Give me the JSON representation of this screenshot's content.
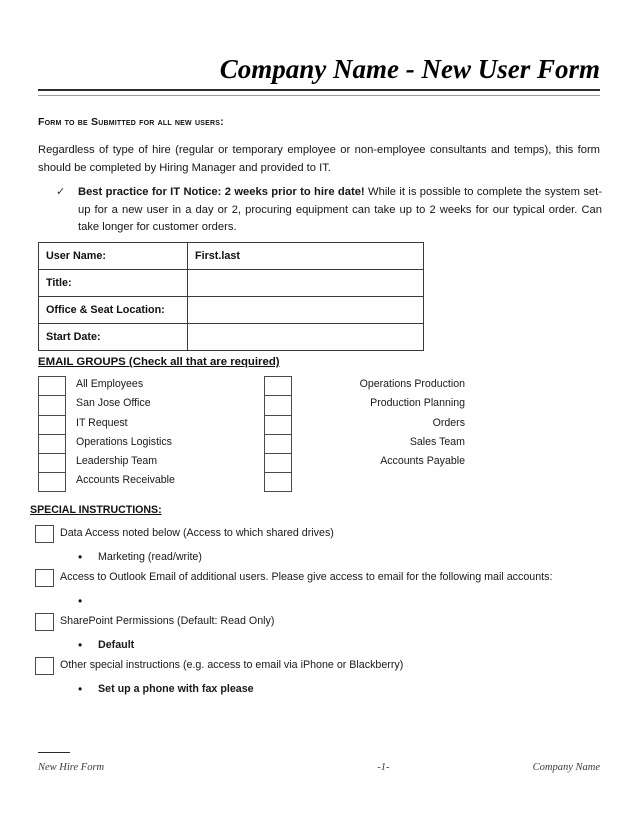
{
  "document": {
    "title": "Company Name - New User Form",
    "subhead": "Form to be Submitted for all new users:",
    "intro": "Regardless of type of hire (regular or temporary employee or non-employee consultants and temps), this form should be completed by Hiring Manager and provided to IT.",
    "note": {
      "bullet_icon": "checkmark-icon",
      "bullet_glyph": "✓",
      "bold_lead": "Best practice for IT Notice:   2 weeks prior to hire date!",
      "rest": " While it is possible to complete the system set-up for a new user in a day or 2, procuring equipment can take up to 2 weeks for our typical order.  Can take longer for customer orders."
    }
  },
  "info_table": {
    "rows": [
      {
        "label": "User Name:",
        "value": "First.last"
      },
      {
        "label": "Title:",
        "value": ""
      },
      {
        "label": "Office & Seat Location:",
        "value": ""
      },
      {
        "label": "Start Date:",
        "value": ""
      }
    ]
  },
  "email_groups": {
    "heading": "EMAIL GROUPS (Check all that are required)",
    "left_column": [
      {
        "label": "All Employees",
        "checked": false
      },
      {
        "label": "San Jose Office",
        "checked": false
      },
      {
        "label": "IT Request",
        "checked": false
      },
      {
        "label": "Operations Logistics",
        "checked": false
      },
      {
        "label": "Leadership Team",
        "checked": false
      },
      {
        "label": "Accounts Receivable",
        "checked": false
      }
    ],
    "right_column": [
      {
        "label": "Operations Production",
        "checked": false
      },
      {
        "label": "Production Planning",
        "checked": false
      },
      {
        "label": "Orders",
        "checked": false
      },
      {
        "label": "Sales Team",
        "checked": false
      },
      {
        "label": "Accounts Payable",
        "checked": false
      },
      {
        "label": "",
        "checked": false
      }
    ]
  },
  "special_instructions": {
    "heading": "SPECIAL INSTRUCTIONS:",
    "items": [
      {
        "label": "Data Access noted below (Access to which shared drives)",
        "checked": false,
        "sub_bullets": [
          {
            "text": "Marketing (read/write)",
            "bold": false
          }
        ]
      },
      {
        "label": "Access to Outlook Email of additional users.  Please give access to email for the following mail accounts:",
        "checked": false,
        "sub_bullets": [
          {
            "text": "",
            "bold": false
          }
        ]
      },
      {
        "label": "SharePoint Permissions (Default: Read Only)",
        "checked": false,
        "sub_bullets": [
          {
            "text": "Default",
            "bold": true
          }
        ]
      },
      {
        "label": "Other special instructions (e.g. access to email via iPhone or Blackberry)",
        "checked": false,
        "sub_bullets": [
          {
            "text": "Set up a phone with fax please",
            "bold": true
          }
        ]
      }
    ]
  },
  "footer": {
    "left": "New Hire Form",
    "center": "-1-",
    "right": "Company Name"
  }
}
